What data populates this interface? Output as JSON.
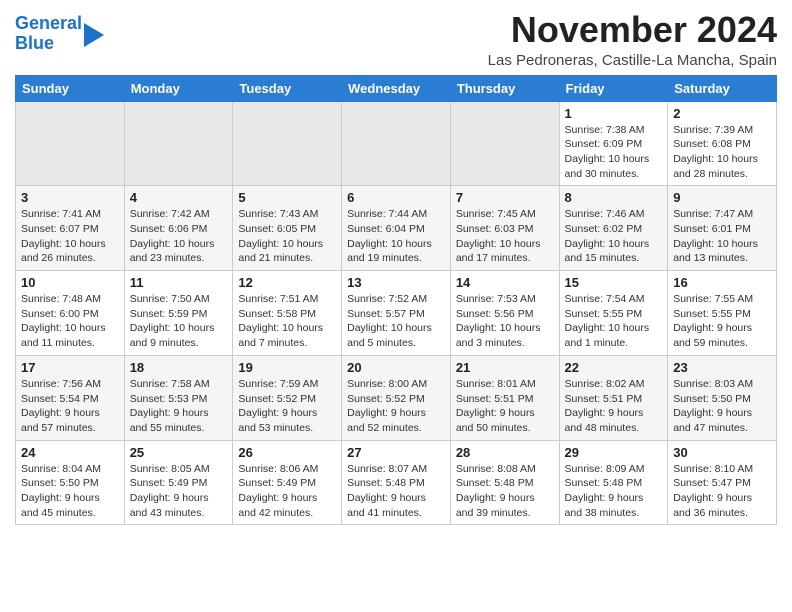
{
  "header": {
    "logo_line1": "General",
    "logo_line2": "Blue",
    "month": "November 2024",
    "location": "Las Pedroneras, Castille-La Mancha, Spain"
  },
  "weekdays": [
    "Sunday",
    "Monday",
    "Tuesday",
    "Wednesday",
    "Thursday",
    "Friday",
    "Saturday"
  ],
  "weeks": [
    [
      {
        "day": "",
        "info": "",
        "empty": true
      },
      {
        "day": "",
        "info": "",
        "empty": true
      },
      {
        "day": "",
        "info": "",
        "empty": true
      },
      {
        "day": "",
        "info": "",
        "empty": true
      },
      {
        "day": "",
        "info": "",
        "empty": true
      },
      {
        "day": "1",
        "info": "Sunrise: 7:38 AM\nSunset: 6:09 PM\nDaylight: 10 hours and 30 minutes."
      },
      {
        "day": "2",
        "info": "Sunrise: 7:39 AM\nSunset: 6:08 PM\nDaylight: 10 hours and 28 minutes."
      }
    ],
    [
      {
        "day": "3",
        "info": "Sunrise: 7:41 AM\nSunset: 6:07 PM\nDaylight: 10 hours and 26 minutes."
      },
      {
        "day": "4",
        "info": "Sunrise: 7:42 AM\nSunset: 6:06 PM\nDaylight: 10 hours and 23 minutes."
      },
      {
        "day": "5",
        "info": "Sunrise: 7:43 AM\nSunset: 6:05 PM\nDaylight: 10 hours and 21 minutes."
      },
      {
        "day": "6",
        "info": "Sunrise: 7:44 AM\nSunset: 6:04 PM\nDaylight: 10 hours and 19 minutes."
      },
      {
        "day": "7",
        "info": "Sunrise: 7:45 AM\nSunset: 6:03 PM\nDaylight: 10 hours and 17 minutes."
      },
      {
        "day": "8",
        "info": "Sunrise: 7:46 AM\nSunset: 6:02 PM\nDaylight: 10 hours and 15 minutes."
      },
      {
        "day": "9",
        "info": "Sunrise: 7:47 AM\nSunset: 6:01 PM\nDaylight: 10 hours and 13 minutes."
      }
    ],
    [
      {
        "day": "10",
        "info": "Sunrise: 7:48 AM\nSunset: 6:00 PM\nDaylight: 10 hours and 11 minutes."
      },
      {
        "day": "11",
        "info": "Sunrise: 7:50 AM\nSunset: 5:59 PM\nDaylight: 10 hours and 9 minutes."
      },
      {
        "day": "12",
        "info": "Sunrise: 7:51 AM\nSunset: 5:58 PM\nDaylight: 10 hours and 7 minutes."
      },
      {
        "day": "13",
        "info": "Sunrise: 7:52 AM\nSunset: 5:57 PM\nDaylight: 10 hours and 5 minutes."
      },
      {
        "day": "14",
        "info": "Sunrise: 7:53 AM\nSunset: 5:56 PM\nDaylight: 10 hours and 3 minutes."
      },
      {
        "day": "15",
        "info": "Sunrise: 7:54 AM\nSunset: 5:55 PM\nDaylight: 10 hours and 1 minute."
      },
      {
        "day": "16",
        "info": "Sunrise: 7:55 AM\nSunset: 5:55 PM\nDaylight: 9 hours and 59 minutes."
      }
    ],
    [
      {
        "day": "17",
        "info": "Sunrise: 7:56 AM\nSunset: 5:54 PM\nDaylight: 9 hours and 57 minutes."
      },
      {
        "day": "18",
        "info": "Sunrise: 7:58 AM\nSunset: 5:53 PM\nDaylight: 9 hours and 55 minutes."
      },
      {
        "day": "19",
        "info": "Sunrise: 7:59 AM\nSunset: 5:52 PM\nDaylight: 9 hours and 53 minutes."
      },
      {
        "day": "20",
        "info": "Sunrise: 8:00 AM\nSunset: 5:52 PM\nDaylight: 9 hours and 52 minutes."
      },
      {
        "day": "21",
        "info": "Sunrise: 8:01 AM\nSunset: 5:51 PM\nDaylight: 9 hours and 50 minutes."
      },
      {
        "day": "22",
        "info": "Sunrise: 8:02 AM\nSunset: 5:51 PM\nDaylight: 9 hours and 48 minutes."
      },
      {
        "day": "23",
        "info": "Sunrise: 8:03 AM\nSunset: 5:50 PM\nDaylight: 9 hours and 47 minutes."
      }
    ],
    [
      {
        "day": "24",
        "info": "Sunrise: 8:04 AM\nSunset: 5:50 PM\nDaylight: 9 hours and 45 minutes."
      },
      {
        "day": "25",
        "info": "Sunrise: 8:05 AM\nSunset: 5:49 PM\nDaylight: 9 hours and 43 minutes."
      },
      {
        "day": "26",
        "info": "Sunrise: 8:06 AM\nSunset: 5:49 PM\nDaylight: 9 hours and 42 minutes."
      },
      {
        "day": "27",
        "info": "Sunrise: 8:07 AM\nSunset: 5:48 PM\nDaylight: 9 hours and 41 minutes."
      },
      {
        "day": "28",
        "info": "Sunrise: 8:08 AM\nSunset: 5:48 PM\nDaylight: 9 hours and 39 minutes."
      },
      {
        "day": "29",
        "info": "Sunrise: 8:09 AM\nSunset: 5:48 PM\nDaylight: 9 hours and 38 minutes."
      },
      {
        "day": "30",
        "info": "Sunrise: 8:10 AM\nSunset: 5:47 PM\nDaylight: 9 hours and 36 minutes."
      }
    ]
  ]
}
